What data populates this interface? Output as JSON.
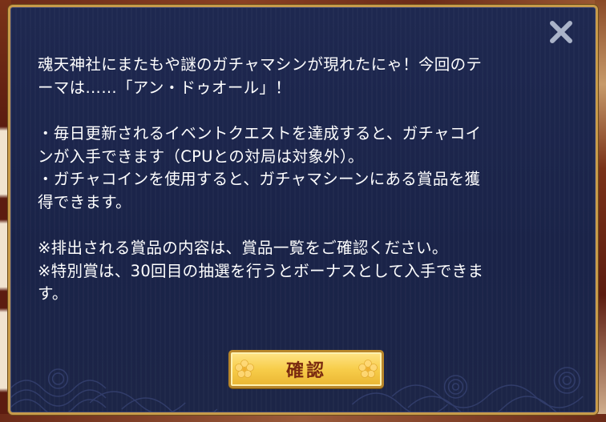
{
  "dialog": {
    "paragraphs": [
      [
        "魂天神社にまたもや謎のガチャマシンが現れたにゃ！今回のテ",
        "ーマは……「アン・ドゥオール」！"
      ],
      [
        "・毎日更新されるイベントクエストを達成すると、ガチャコイ",
        "ンが入手できます（CPUとの対局は対象外）。",
        "・ガチャコインを使用すると、ガチャマシーンにある賞品を獲",
        "得できます。"
      ],
      [
        "※排出される賞品の内容は、賞品一覧をご確認ください。",
        "※特別賞は、30回目の抽選を行うとボーナスとして入手できま",
        "す。"
      ]
    ],
    "confirm_label": "確認",
    "close_icon": "close-icon"
  },
  "colors": {
    "dialog_bg": "#1e2850",
    "border_gold": "#c89b4a",
    "button_gold": "#f7cd4a",
    "button_text": "#7a2a10"
  }
}
